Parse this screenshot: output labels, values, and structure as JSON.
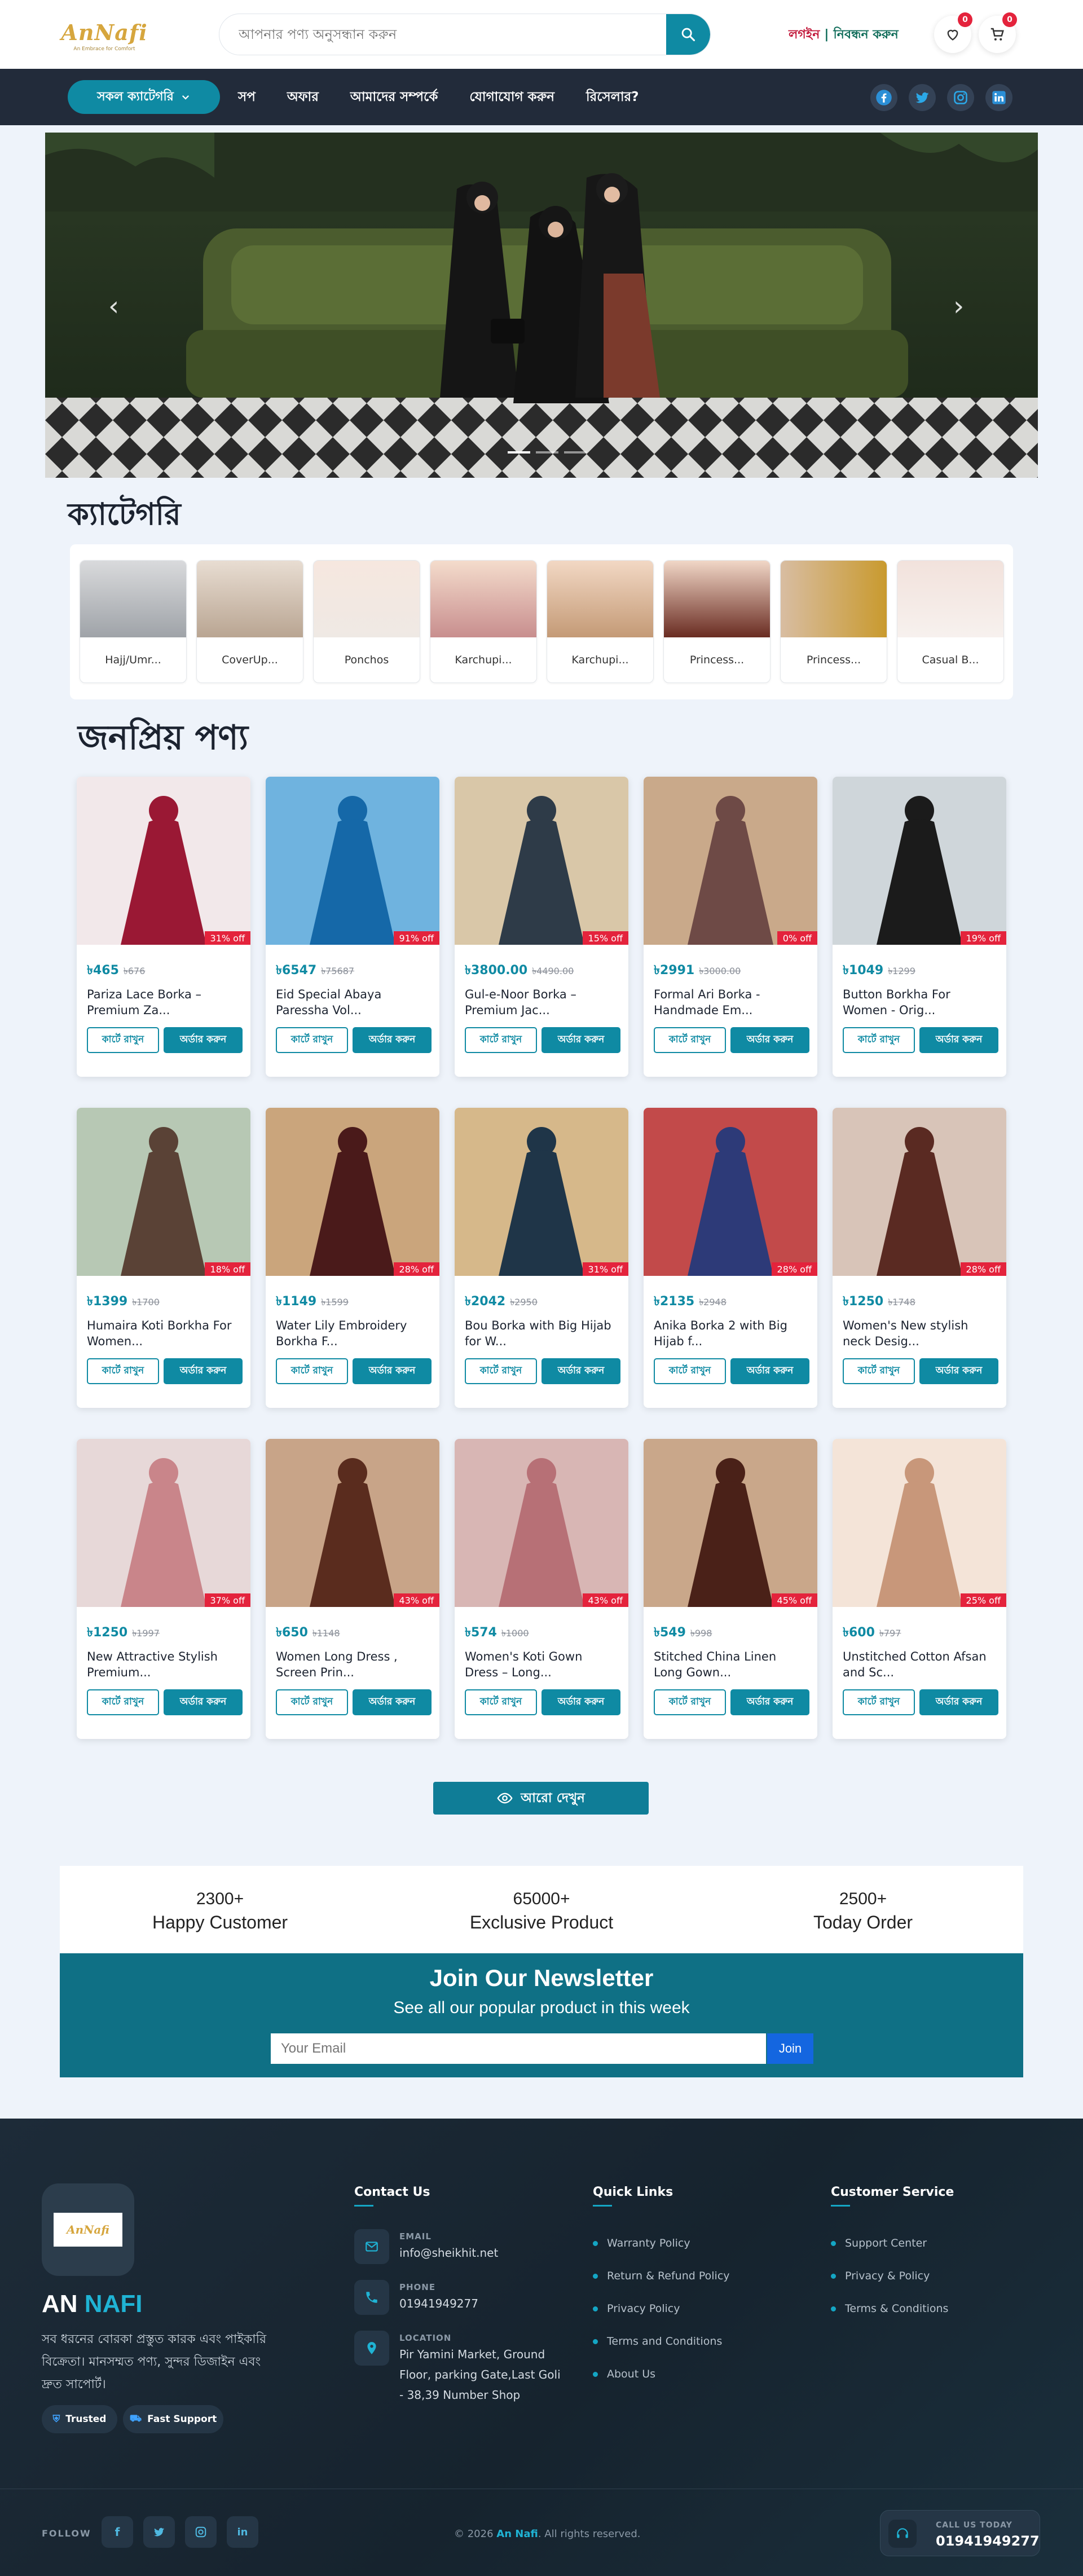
{
  "header": {
    "logo_text": "AnNafi",
    "logo_tagline": "An Embrace for Comfort",
    "search_placeholder": "আপনার পণ্য অনুসন্ধান করুন",
    "login": "লগইন",
    "separator": "|",
    "register": "নিবন্ধন করুন",
    "wishlist_count": "0",
    "cart_count": "0"
  },
  "nav": {
    "all_categories": "সকল ক্যাটেগরি",
    "links": [
      "সপ",
      "অফার",
      "আমাদের সম্পর্কে",
      "যোগাযোগ করুন",
      "রিসেলার?"
    ]
  },
  "categories": {
    "title": "ক্যাটেগরি",
    "items": [
      "Hajj/Umr...",
      "CoverUp...",
      "Ponchos",
      "Karchupi...",
      "Karchupi...",
      "Princess...",
      "Princess...",
      "Casual B..."
    ]
  },
  "popular": {
    "title": "জনপ্রিয় পণ্য",
    "currency": "৳",
    "cart_label": "কার্টে রাখুন",
    "order_label": "অর্ডার করুন",
    "products": [
      {
        "name": "Pariza Lace Borka – Premium Za...",
        "price": "465",
        "old": "676",
        "off": "31% off"
      },
      {
        "name": "Eid Special Abaya Paressha Vol...",
        "price": "6547",
        "old": "75687",
        "off": "91% off"
      },
      {
        "name": "Gul-e-Noor Borka – Premium Jac...",
        "price": "3800.00",
        "old": "4490.00",
        "off": "15% off"
      },
      {
        "name": "Formal Ari Borka - Handmade Em...",
        "price": "2991",
        "old": "3000.00",
        "off": "0% off"
      },
      {
        "name": "Button Borkha For Women - Orig...",
        "price": "1049",
        "old": "1299",
        "off": "19% off"
      },
      {
        "name": "Humaira Koti Borkha For Women...",
        "price": "1399",
        "old": "1700",
        "off": "18% off"
      },
      {
        "name": "Water Lily Embroidery Borkha F...",
        "price": "1149",
        "old": "1599",
        "off": "28% off"
      },
      {
        "name": "Bou Borka with Big Hijab for W...",
        "price": "2042",
        "old": "2950",
        "off": "31% off"
      },
      {
        "name": "Anika Borka 2 with Big Hijab f...",
        "price": "2135",
        "old": "2948",
        "off": "28% off"
      },
      {
        "name": "Women's New stylish neck Desig...",
        "price": "1250",
        "old": "1748",
        "off": "28% off"
      },
      {
        "name": "New Attractive Stylish Premium...",
        "price": "1250",
        "old": "1997",
        "off": "37% off"
      },
      {
        "name": "Women Long Dress , Screen Prin...",
        "price": "650",
        "old": "1148",
        "off": "43% off"
      },
      {
        "name": "Women's Koti Gown Dress – Long...",
        "price": "574",
        "old": "1000",
        "off": "43% off"
      },
      {
        "name": "Stitched China Linen Long Gown...",
        "price": "549",
        "old": "998",
        "off": "45% off"
      },
      {
        "name": "Unstitched Cotton Afsan and Sc...",
        "price": "600",
        "old": "797",
        "off": "25% off"
      }
    ],
    "see_more": "আরো দেখুন"
  },
  "stats": [
    {
      "number": "2300+",
      "label": "Happy Customer"
    },
    {
      "number": "65000+",
      "label": "Exclusive Product"
    },
    {
      "number": "2500+",
      "label": "Today Order"
    }
  ],
  "newsletter": {
    "title": "Join Our Newsletter",
    "subtitle": "See all our popular product in this week",
    "placeholder": "Your Email",
    "button": "Join"
  },
  "footer": {
    "brand_first": "AN",
    "brand_second": "NAFI",
    "description": "সব ধরনের বোরকা প্রস্তুত কারক এবং পাইকারি বিক্রেতা। মানসম্মত পণ্য, সুন্দর ডিজাইন এবং দ্রুত সাপোর্ট।",
    "badge_trusted": "Trusted",
    "badge_support": "Fast Support",
    "contact_title": "Contact Us",
    "email_label": "EMAIL",
    "email": "info@sheikhit.net",
    "phone_label": "PHONE",
    "phone": "01941949277",
    "location_label": "LOCATION",
    "location": "Pir Yamini Market, Ground Floor, parking Gate,Last Goli - 38,39 Number Shop",
    "quick_title": "Quick Links",
    "quick_links": [
      "Warranty Policy",
      "Return & Refund Policy",
      "Privacy Policy",
      "Terms and Conditions",
      "About Us"
    ],
    "service_title": "Customer Service",
    "service_links": [
      "Support Center",
      "Privacy & Policy",
      "Terms & Conditions"
    ],
    "follow": "FOLLOW",
    "copyright_pre": "© 2026",
    "copyright_brand": "An Nafi",
    "copyright_post": ". All rights reserved.",
    "call_label": "CALL US TODAY",
    "call_number": "01941949277"
  },
  "colors": {
    "accent": "#0f8aa3",
    "nav_bg": "#222b3a",
    "discount": "#e4233c",
    "footer_bg": "#1d2b38"
  }
}
